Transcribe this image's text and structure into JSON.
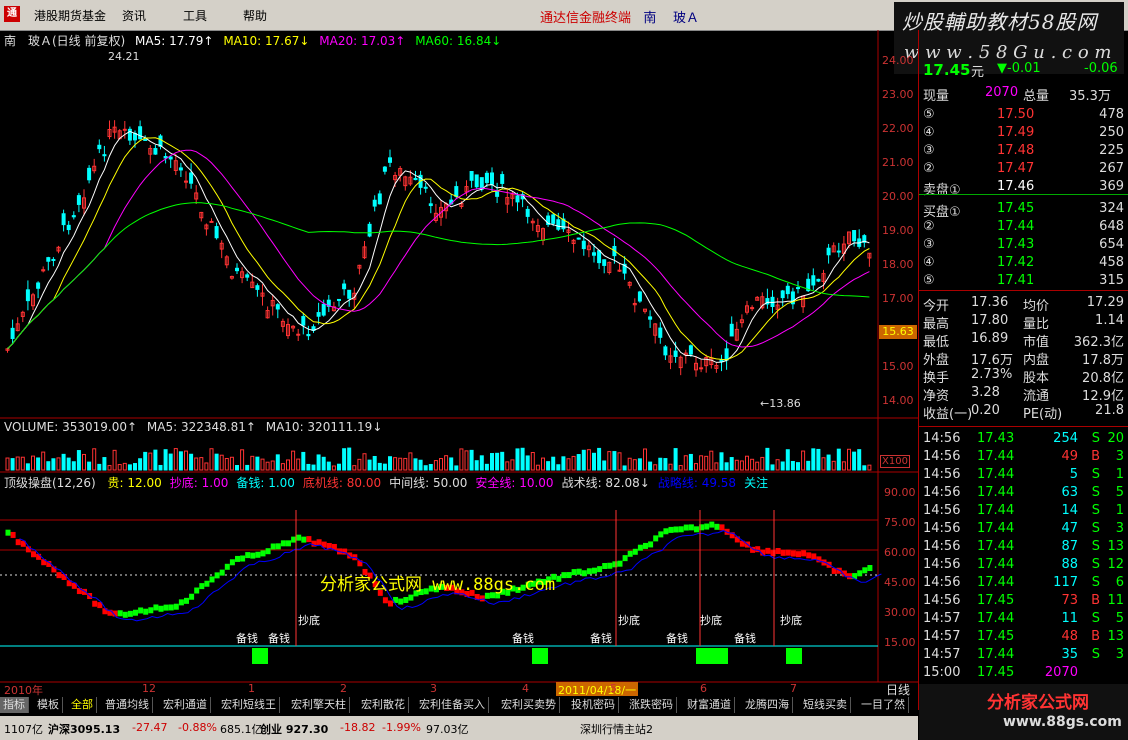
{
  "menubar": {
    "items": [
      "港股期货基金",
      "资讯",
      "工具",
      "帮助"
    ],
    "title_parts": [
      "通达信金融终端",
      "南",
      "玻Ａ"
    ]
  },
  "watermark_top": {
    "line1": "炒股輔助教材58股网",
    "line2": "w w w . 5 8 G u . c o m"
  },
  "main_chart": {
    "title": "南　玻Ａ(日线 前复权)",
    "ma5": "MA5: 17.79↑",
    "ma10": "MA10: 17.67↓",
    "ma20": "MA20: 17.03↑",
    "ma60": "MA60: 16.84↓",
    "high_label": "24.21",
    "low_label": "←13.86",
    "price_ticks": [
      "24.00",
      "23.00",
      "22.00",
      "21.00",
      "20.00",
      "19.00",
      "18.00",
      "17.00",
      "16.00",
      "15.00",
      "14.00"
    ],
    "current_price_tag": "15.63"
  },
  "volume_panel": {
    "title": "VOLUME: 353019.00↑",
    "ma5": "MA5: 322348.81↑",
    "ma10": "MA10: 320111.19↓",
    "unit": "X100"
  },
  "indicator_panel": {
    "name": "顶级操盘(12,26)",
    "params": [
      {
        "label": "贵: 12.00",
        "color": "#ff0"
      },
      {
        "label": "抄底: 1.00",
        "color": "#f0f"
      },
      {
        "label": "备钱: 1.00",
        "color": "#0ff"
      },
      {
        "label": "底机线: 80.00",
        "color": "#f33"
      },
      {
        "label": "中间线: 50.00",
        "color": "#ddd"
      },
      {
        "label": "安全线: 10.00",
        "color": "#f0f"
      },
      {
        "label": "战术线: 82.08↓",
        "color": "#ddd"
      },
      {
        "label": "战略线: 49.58",
        "color": "#00f"
      },
      {
        "label": "关注",
        "color": "#0ff"
      }
    ],
    "ticks": [
      "90.00",
      "75.00",
      "60.00",
      "45.00",
      "30.00",
      "15.00"
    ],
    "watermark": "分析家公式网 www.88gs.com",
    "annotations": [
      "备钱",
      "备钱",
      "抄底",
      "备钱",
      "备钱",
      "抄底",
      "备钱",
      "抄底",
      "备钱",
      "抄底"
    ]
  },
  "date_axis": {
    "left": "2010年",
    "marker": "2011/04/18/一",
    "labels": [
      "12",
      "1",
      "2",
      "3",
      "4",
      "5",
      "6",
      "7"
    ]
  },
  "period_label": "日线",
  "quote": {
    "price": "17.45",
    "price_unit": "元",
    "change": "▼-0.01",
    "change2": "-0.06",
    "now_vol_label": "现量",
    "now_vol": "2070",
    "total_vol_label": "总量",
    "total_vol": "35.3万",
    "asks": [
      {
        "lvl": "⑤",
        "price": "17.50",
        "vol": "478"
      },
      {
        "lvl": "④",
        "price": "17.49",
        "vol": "250"
      },
      {
        "lvl": "③",
        "price": "17.48",
        "vol": "225"
      },
      {
        "lvl": "②",
        "price": "17.47",
        "vol": "267"
      },
      {
        "lvl": "卖盘①",
        "price": "17.46",
        "vol": "369"
      }
    ],
    "bids": [
      {
        "lvl": "买盘①",
        "price": "17.45",
        "vol": "324"
      },
      {
        "lvl": "②",
        "price": "17.44",
        "vol": "648"
      },
      {
        "lvl": "③",
        "price": "17.43",
        "vol": "654"
      },
      {
        "lvl": "④",
        "price": "17.42",
        "vol": "458"
      },
      {
        "lvl": "⑤",
        "price": "17.41",
        "vol": "315"
      }
    ],
    "stats": [
      [
        "今开",
        "17.36",
        "均价",
        "17.29"
      ],
      [
        "最高",
        "17.80",
        "量比",
        "1.14"
      ],
      [
        "最低",
        "16.89",
        "市值",
        "362.3亿"
      ],
      [
        "外盘",
        "17.6万",
        "内盘",
        "17.8万"
      ],
      [
        "换手",
        "2.73%",
        "股本",
        "20.8亿"
      ],
      [
        "净资",
        "3.28",
        "流通",
        "12.9亿"
      ],
      [
        "收益(一)",
        "0.20",
        "PE(动)",
        "21.8"
      ]
    ],
    "ticks": [
      [
        "14:56",
        "17.43",
        "254",
        "S",
        "20"
      ],
      [
        "14:56",
        "17.44",
        "49",
        "B",
        "3"
      ],
      [
        "14:56",
        "17.44",
        "5",
        "S",
        "1"
      ],
      [
        "14:56",
        "17.44",
        "63",
        "S",
        "5"
      ],
      [
        "14:56",
        "17.44",
        "14",
        "S",
        "1"
      ],
      [
        "14:56",
        "17.44",
        "47",
        "S",
        "3"
      ],
      [
        "14:56",
        "17.44",
        "87",
        "S",
        "13"
      ],
      [
        "14:56",
        "17.44",
        "88",
        "S",
        "12"
      ],
      [
        "14:56",
        "17.44",
        "117",
        "S",
        "6"
      ],
      [
        "14:56",
        "17.45",
        "73",
        "B",
        "11"
      ],
      [
        "14:57",
        "17.44",
        "11",
        "S",
        "5"
      ],
      [
        "14:57",
        "17.45",
        "48",
        "B",
        "13"
      ],
      [
        "14:57",
        "17.44",
        "35",
        "S",
        "3"
      ],
      [
        "15:00",
        "17.45",
        "2070",
        "",
        ""
      ]
    ]
  },
  "tabs": [
    "指标",
    "模板",
    "全部",
    "普通均线",
    "宏利通道",
    "宏利短线王",
    "宏利擎天柱",
    "宏利散花",
    "宏利佳备买入",
    "宏利买卖势",
    "投机密码",
    "涨跌密码",
    "财富通道",
    "龙腾四海",
    "短线买卖",
    "一目了然"
  ],
  "status": {
    "s1": "1107亿",
    "s2": "沪深3095.13",
    "s3": "-27.47",
    "s4": "-0.88%",
    "s5": "685.1亿",
    "s6": "创业 927.30",
    "s7": "-18.82",
    "s8": "-1.99%",
    "s9": "97.03亿",
    "s10": "深圳行情主站2"
  },
  "logo_bottom": {
    "line1": "分析家公式网",
    "line2": "www.88gs.com"
  },
  "colors": {
    "up": "#ff3333",
    "down": "#00ffff",
    "ma5": "#ffffff",
    "ma10": "#ffff00",
    "ma20": "#ff00ff",
    "ma60": "#00ff00",
    "frame": "#aa0000"
  }
}
